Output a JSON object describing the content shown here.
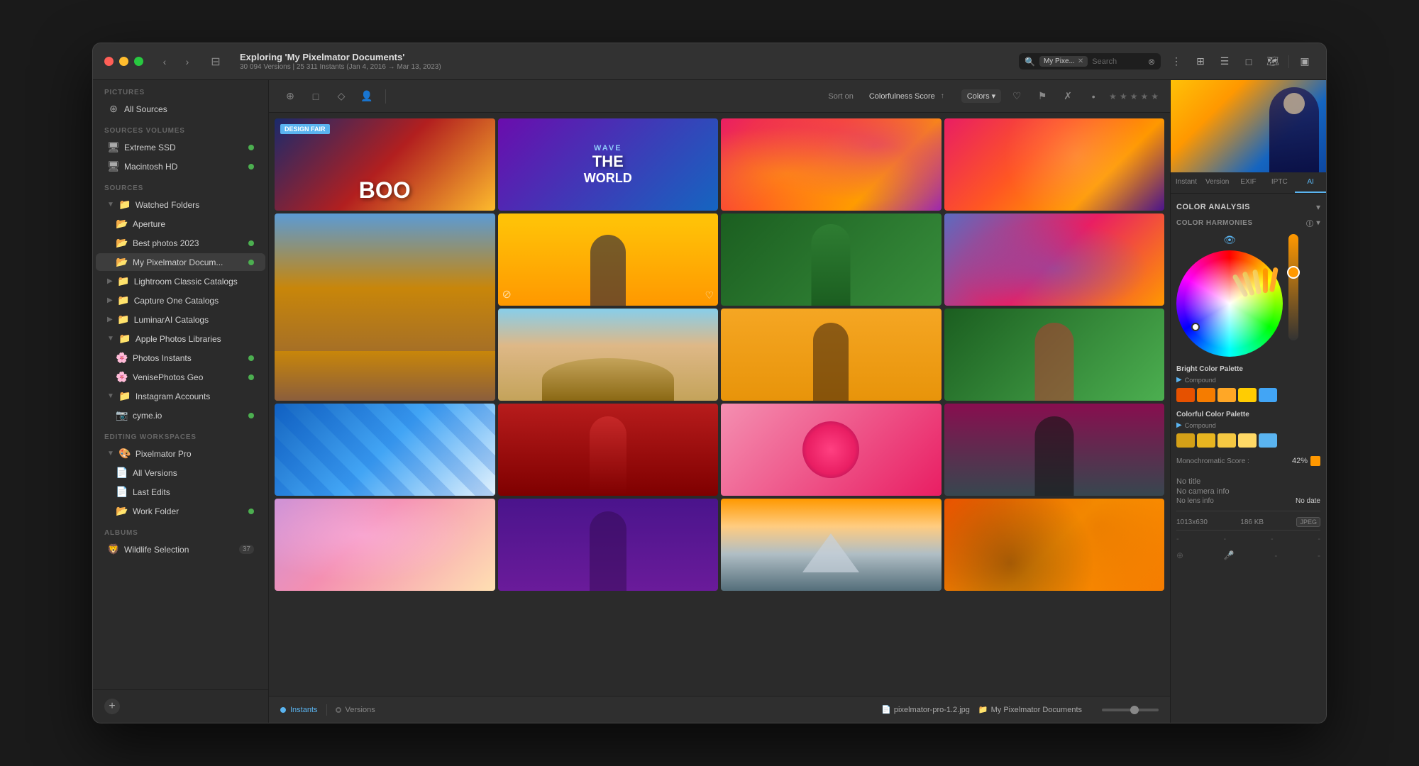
{
  "window": {
    "title": "Exploring 'My Pixelmator Documents'",
    "subtitle": "30 094 Versions | 25 311 Instants (Jan 4, 2016 → Mar 13, 2023)",
    "traffic_lights": [
      "close",
      "minimize",
      "fullscreen"
    ]
  },
  "toolbar": {
    "back_label": "‹",
    "forward_label": "›",
    "search_tag": "My Pixe...",
    "search_placeholder": "Search",
    "sort_label": "Sort on",
    "sort_value": "Colorfulness Score",
    "sort_arrows": "↑↓",
    "colors_label": "Colors",
    "view_icons": [
      "⊞",
      "☰",
      "□",
      "🗺"
    ]
  },
  "content_toolbar": {
    "icons": [
      "⊕",
      "□",
      "◇",
      "👤"
    ],
    "sort_label": "Sort on",
    "sort_field": "Colorfulness Score ↑↓",
    "colors_btn": "Colors ▾",
    "star_icons": [
      "★",
      "★",
      "★",
      "★",
      "★"
    ]
  },
  "sidebar": {
    "pictures_label": "Pictures",
    "all_sources_label": "All Sources",
    "sources_volumes_label": "Sources Volumes",
    "volumes": [
      {
        "name": "Extreme SSD",
        "has_dot": true
      },
      {
        "name": "Macintosh HD",
        "has_dot": true
      }
    ],
    "sources_label": "Sources",
    "watched_folders_label": "Watched Folders",
    "watched_folder_items": [
      {
        "name": "Aperture",
        "has_dot": false
      },
      {
        "name": "Best photos 2023",
        "has_dot": true
      },
      {
        "name": "My Pixelmator Docum...",
        "has_dot": true,
        "active": true
      }
    ],
    "catalogs": [
      {
        "name": "Lightroom Classic Catalogs",
        "expanded": false
      },
      {
        "name": "Capture One Catalogs",
        "expanded": false
      },
      {
        "name": "LuminarAI Catalogs",
        "expanded": false
      }
    ],
    "apple_photos_label": "Apple Photos Libraries",
    "apple_photos_items": [
      {
        "name": "Photos Instants",
        "has_dot": true
      },
      {
        "name": "VenisePhotos Geo",
        "has_dot": true
      }
    ],
    "instagram_label": "Instagram Accounts",
    "instagram_items": [
      {
        "name": "cyme.io",
        "has_dot": true
      }
    ],
    "editing_label": "Editing Workspaces",
    "editing_app": "Pixelmator Pro",
    "editing_items": [
      {
        "name": "All Versions"
      },
      {
        "name": "Last Edits"
      },
      {
        "name": "Work Folder",
        "has_dot": true
      }
    ],
    "albums_label": "Albums",
    "wildlife_label": "Wildlife Selection",
    "wildlife_count": "37",
    "add_btn_label": "+"
  },
  "grid": {
    "photos": [
      {
        "id": 1,
        "bg": "design-fair",
        "label": "DESIGN FAIR",
        "type": "design"
      },
      {
        "id": 2,
        "bg": "wave-world",
        "label": "WAVE THE WORLD",
        "type": "text"
      },
      {
        "id": 3,
        "bg": "colorful-abstract",
        "label": "",
        "type": "abstract"
      },
      {
        "id": 4,
        "bg": "desert",
        "label": "",
        "type": "photo",
        "span2": true
      },
      {
        "id": 5,
        "bg": "yellow-man",
        "label": "",
        "type": "portrait"
      },
      {
        "id": 6,
        "bg": "green-woman",
        "label": "",
        "type": "portrait"
      },
      {
        "id": 7,
        "bg": "3d-shapes",
        "label": "",
        "type": "art"
      },
      {
        "id": 8,
        "bg": "rock-arch",
        "label": "",
        "type": "landscape"
      },
      {
        "id": 9,
        "bg": "yellow-girl",
        "label": "",
        "type": "portrait"
      },
      {
        "id": 10,
        "bg": "green-action",
        "label": "",
        "type": "photo"
      },
      {
        "id": 11,
        "bg": "blue-pattern",
        "label": "",
        "type": "art"
      },
      {
        "id": 12,
        "bg": "red-woman",
        "label": "",
        "type": "portrait"
      },
      {
        "id": 13,
        "bg": "pink-flower",
        "label": "",
        "type": "photo"
      },
      {
        "id": 14,
        "bg": "dark-woman",
        "label": "",
        "type": "portrait"
      },
      {
        "id": 15,
        "bg": "gradient-abstract",
        "label": "",
        "type": "abstract"
      },
      {
        "id": 16,
        "bg": "purple-woman",
        "label": "",
        "type": "portrait"
      },
      {
        "id": 17,
        "bg": "mountain-lake",
        "label": "",
        "type": "landscape"
      },
      {
        "id": 18,
        "bg": "autumn-art",
        "label": "",
        "type": "art"
      }
    ]
  },
  "inspector": {
    "tabs": [
      "Instant",
      "Version",
      "EXIF",
      "IPTC",
      "AI"
    ],
    "active_tab": "AI",
    "section": "COLOR ANALYSIS",
    "harmonies_label": "COLOR HARMONIES",
    "bright_palette_label": "Bright Color Palette",
    "bright_compound": "Compound",
    "bright_swatches": [
      "#e65100",
      "#f57c00",
      "#ffa726",
      "#ffcc02",
      "#42a5f5"
    ],
    "colorful_palette_label": "Colorful Color Palette",
    "colorful_compound": "Compound",
    "colorful_swatches": [
      "#d4a017",
      "#e8b520",
      "#f5c842",
      "#ffd966",
      "#5ab4f0"
    ],
    "monochromatic_label": "Monochromatic Score :",
    "monochromatic_value": "42%",
    "title_no": "No title",
    "camera_no": "No camera info",
    "lens_no": "No lens info",
    "date_no": "No date",
    "dimensions": "1013x630",
    "file_size": "186 KB",
    "file_format": "JPEG",
    "dashes": [
      "-",
      "-",
      "-",
      "-"
    ],
    "footer_icons": [
      "⊕",
      "🎤",
      "•",
      "•"
    ]
  },
  "bottom_bar": {
    "instants_label": "Instants",
    "versions_label": "Versions",
    "filename": "pixelmator-pro-1.2.jpg",
    "folder": "My Pixelmator Documents"
  }
}
